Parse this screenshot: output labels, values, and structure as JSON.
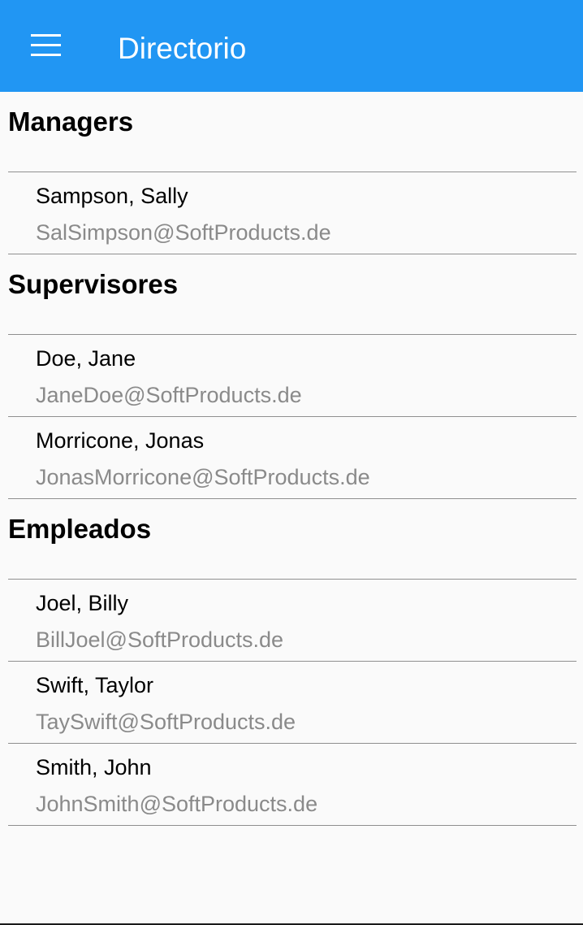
{
  "app_bar": {
    "title": "Directorio",
    "menu_icon": "hamburger-menu-icon",
    "background_color": "#2196f3"
  },
  "groups": [
    {
      "header": "Managers",
      "items": [
        {
          "name": "Sampson, Sally",
          "email": "SalSimpson@SoftProducts.de"
        }
      ]
    },
    {
      "header": "Supervisores",
      "items": [
        {
          "name": "Doe, Jane",
          "email": "JaneDoe@SoftProducts.de"
        },
        {
          "name": "Morricone, Jonas",
          "email": "JonasMorricone@SoftProducts.de"
        }
      ]
    },
    {
      "header": "Empleados",
      "items": [
        {
          "name": "Joel, Billy",
          "email": "BillJoel@SoftProducts.de"
        },
        {
          "name": "Swift, Taylor",
          "email": "TaySwift@SoftProducts.de"
        },
        {
          "name": "Smith, John",
          "email": "JohnSmith@SoftProducts.de"
        }
      ]
    }
  ]
}
